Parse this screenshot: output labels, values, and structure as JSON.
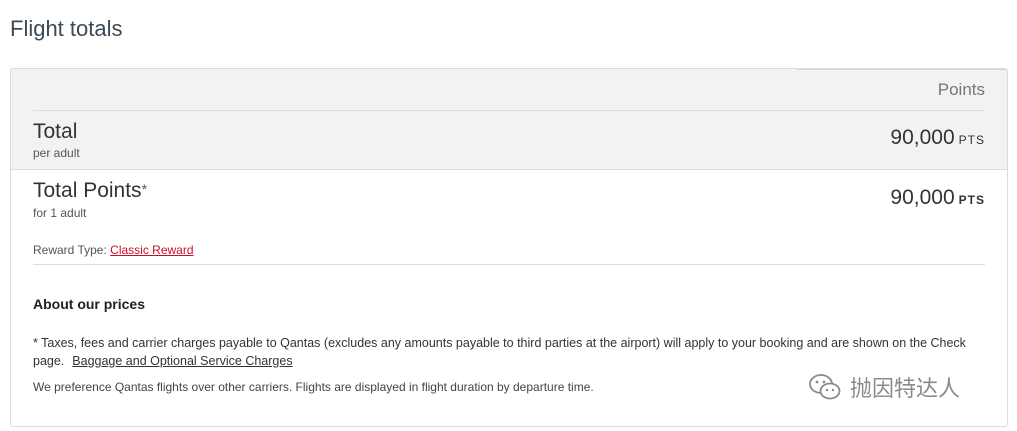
{
  "page": {
    "title": "Flight totals"
  },
  "summary": {
    "column_header": "Points",
    "total": {
      "label": "Total",
      "sublabel": "per adult",
      "amount": "90,000",
      "unit": "PTS"
    },
    "total_points": {
      "label": "Total Points",
      "asterisk": "*",
      "sublabel": "for 1 adult",
      "amount": "90,000",
      "unit": "PTS"
    },
    "reward_type": {
      "label": "Reward Type:",
      "value": "Classic Reward"
    }
  },
  "about": {
    "heading": "About our prices",
    "taxes_note": "* Taxes, fees and carrier charges payable to Qantas (excludes any amounts payable to third parties at the airport) will apply to your booking and are shown on the Check page.",
    "baggage_link": "Baggage and Optional Service Charges",
    "preference_note": "We preference Qantas flights over other carriers.  Flights are displayed in flight duration by departure time."
  },
  "watermark": {
    "icon": "wechat-icon",
    "text": "抛因特达人"
  },
  "colors": {
    "link_red": "#c8102e",
    "band_gray": "#f2f2f2",
    "title": "#3c4a55"
  }
}
